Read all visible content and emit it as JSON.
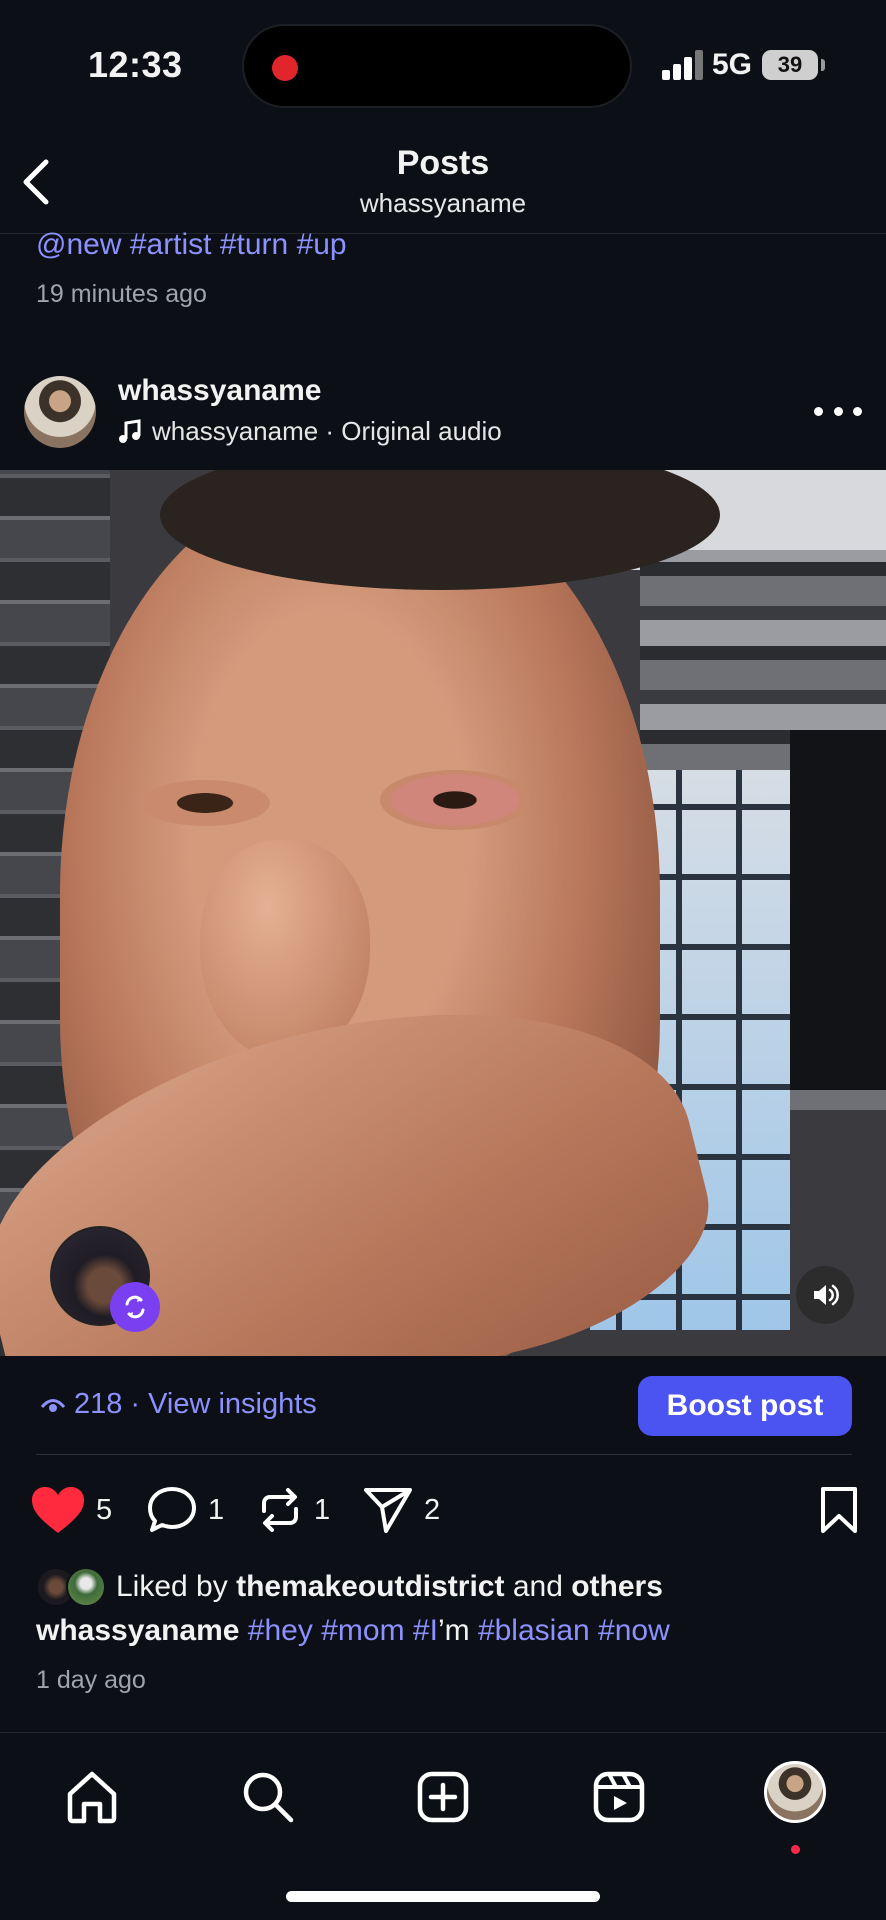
{
  "status_bar": {
    "time": "12:33",
    "network": "5G",
    "battery": "39",
    "recording_color": "#e0262b"
  },
  "header": {
    "title": "Posts",
    "subtitle": "whassyaname",
    "back_icon": "chevron-left-icon"
  },
  "previous_post": {
    "tags": "@new #artist #turn #up",
    "time": "19 minutes ago"
  },
  "post": {
    "username": "whassyaname",
    "audio": "whassyaname · Original audio",
    "audio_icon": "music-note-icon",
    "more_icon": "more-horizontal-icon",
    "media_type": "reel-video",
    "sound_icon": "speaker-icon",
    "remix_icon": "remix-icon"
  },
  "insights": {
    "views": "218",
    "separator": "·",
    "link": "View insights",
    "boost_label": "Boost post",
    "accent": "#4b53f0",
    "link_color": "#8c91ff"
  },
  "actions": {
    "likes": "5",
    "comments": "1",
    "reposts": "1",
    "shares": "2",
    "liked": true,
    "like_color": "#ff2a3d"
  },
  "caption": {
    "liked_prefix": "Liked by",
    "liked_user": "themakeoutdistrict",
    "liked_and": "and",
    "liked_others": "others",
    "username": "whassyaname",
    "text_parts": [
      {
        "text": "#hey",
        "tag": true
      },
      {
        "text": " ",
        "tag": false
      },
      {
        "text": "#mom",
        "tag": true
      },
      {
        "text": " ",
        "tag": false
      },
      {
        "text": "#I",
        "tag": true
      },
      {
        "text": "’m ",
        "tag": false
      },
      {
        "text": "#blasian",
        "tag": true
      },
      {
        "text": " ",
        "tag": false
      },
      {
        "text": "#now",
        "tag": true
      }
    ],
    "time": "1 day ago"
  },
  "bottom_nav": {
    "items": [
      "home-icon",
      "search-icon",
      "create-icon",
      "reels-icon",
      "profile-avatar"
    ],
    "notification_dot": "#ff2a4a"
  }
}
